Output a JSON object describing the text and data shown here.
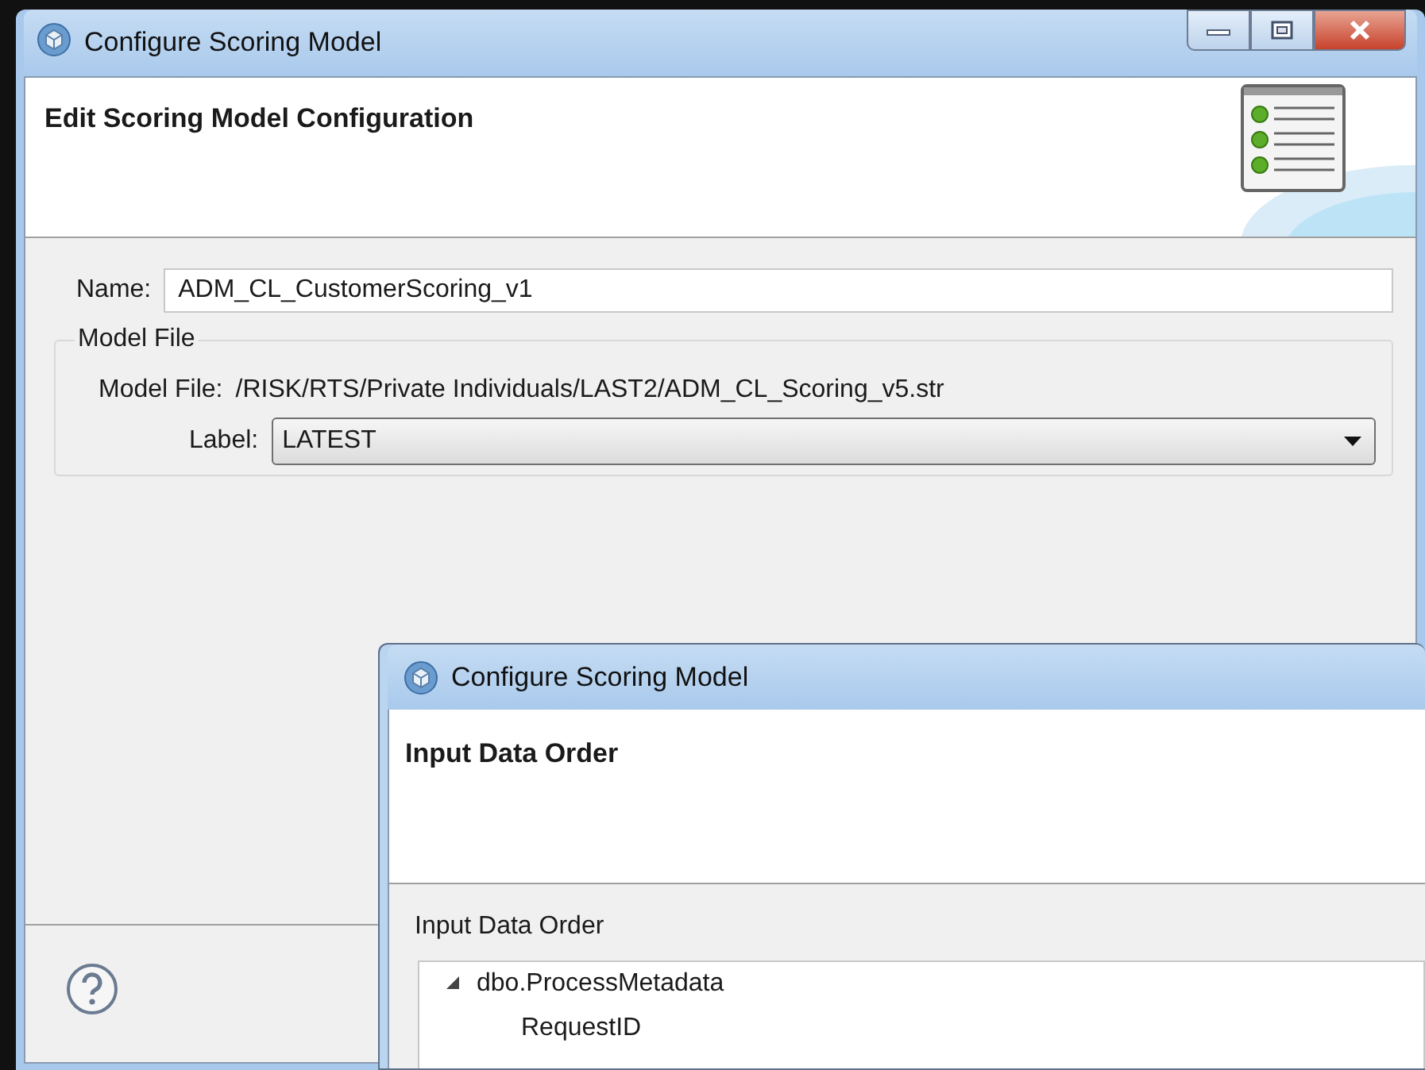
{
  "main_window": {
    "title": "Configure Scoring Model",
    "header": {
      "title": "Edit Scoring Model Configuration"
    },
    "name_field": {
      "label": "Name:",
      "value": "ADM_CL_CustomerScoring_v1"
    },
    "model_file_group": {
      "title": "Model File",
      "model_file": {
        "label": "Model File:",
        "value": "/RISK/RTS/Private Individuals/LAST2/ADM_CL_Scoring_v5.str"
      },
      "label_combo": {
        "label": "Label:",
        "value": "LATEST"
      }
    }
  },
  "front_window": {
    "title": "Configure Scoring Model",
    "header": {
      "title": "Input Data Order"
    },
    "section_label": "Input Data Order",
    "tree": [
      {
        "label": "dbo.ProcessMetadata",
        "expanded": true,
        "children": [
          {
            "label": "RequestID"
          }
        ]
      }
    ]
  }
}
